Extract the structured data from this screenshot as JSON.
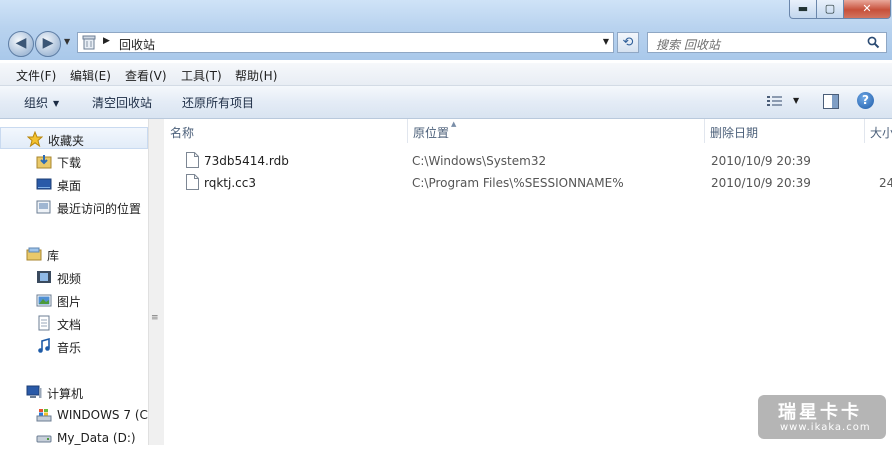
{
  "window": {
    "controls": {
      "minimize": "▬",
      "maximize": "▢",
      "close": "✕"
    }
  },
  "nav": {
    "back": "◀",
    "forward": "▶",
    "history": "▼"
  },
  "address": {
    "path": "回收站",
    "separator": "▶",
    "dropdown": "▼"
  },
  "refresh": "⟲",
  "search": {
    "placeholder": "搜索 回收站"
  },
  "menu": [
    "文件(F)",
    "编辑(E)",
    "查看(V)",
    "工具(T)",
    "帮助(H)"
  ],
  "commands": {
    "organize": "组织",
    "organize_caret": "▼",
    "empty": "清空回收站",
    "restore_all": "还原所有项目",
    "view_caret": "▼",
    "help": "?"
  },
  "sidebar": {
    "favorites": {
      "label": "收藏夹",
      "items": [
        "下载",
        "桌面",
        "最近访问的位置"
      ]
    },
    "libraries": {
      "label": "库",
      "items": [
        "视频",
        "图片",
        "文档",
        "音乐"
      ]
    },
    "computer": {
      "label": "计算机",
      "items": [
        "WINDOWS 7 (C",
        "My_Data (D:)"
      ]
    }
  },
  "columns": {
    "name": "名称",
    "location": "原位置",
    "deleted": "删除日期",
    "size": "大小"
  },
  "files": [
    {
      "name": "73db5414.rdb",
      "location": "C:\\Windows\\System32",
      "deleted": "2010/10/9 20:39",
      "size": ""
    },
    {
      "name": "rqktj.cc3",
      "location": "C:\\Program Files\\%SESSIONNAME%",
      "deleted": "2010/10/9 20:39",
      "size": "24"
    }
  ],
  "watermark": {
    "title": "瑞星卡卡",
    "url": "www.ikaka.com"
  },
  "colors": {
    "accent": "#1f5ca8",
    "titlebar": "#b9d3ef",
    "selection": "#e2ecf8"
  }
}
